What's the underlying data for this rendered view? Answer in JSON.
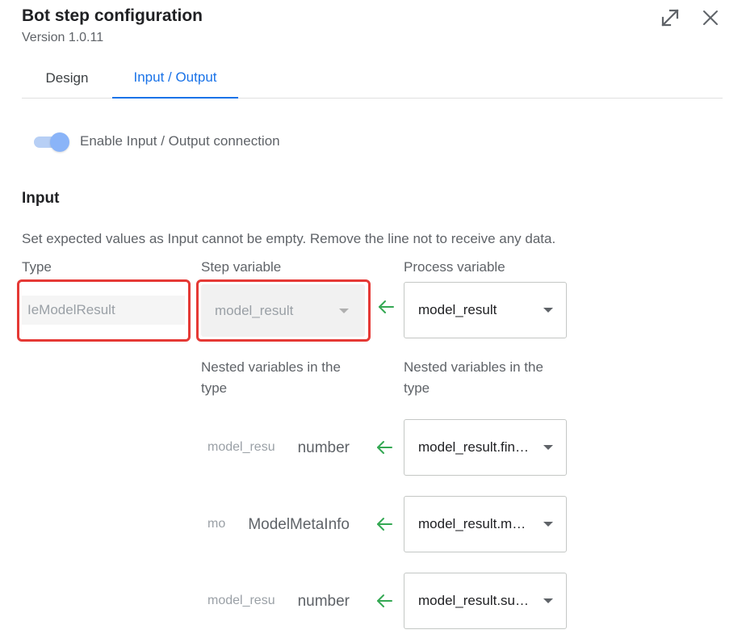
{
  "header": {
    "title": "Bot step configuration",
    "version": "Version 1.0.11"
  },
  "tabs": [
    {
      "label": "Design",
      "active": false
    },
    {
      "label": "Input / Output",
      "active": true
    }
  ],
  "toggle": {
    "label": "Enable Input / Output connection",
    "enabled": true
  },
  "input": {
    "title": "Input",
    "description": "Set expected values as Input cannot be empty. Remove the line not to receive any data.",
    "columns": {
      "type": "Type",
      "step_variable": "Step variable",
      "process_variable": "Process variable"
    },
    "main_row": {
      "type_value": "IeModelResult",
      "step_variable": "model_result",
      "process_variable": "model_result"
    },
    "nested_label": "Nested variables in the type",
    "nested_rows": [
      {
        "name": "model_resu",
        "type": "number",
        "process_variable": "model_result.fin…"
      },
      {
        "name": "mo",
        "type": "ModelMetaInfo",
        "process_variable": "model_result.m…"
      },
      {
        "name": "model_resu",
        "type": "number",
        "process_variable": "model_result.su…"
      }
    ]
  },
  "colors": {
    "accent": "#1a73e8",
    "highlight": "#e53935",
    "arrow": "#34a853"
  },
  "icons": {
    "expand": "expand-icon",
    "close": "close-icon",
    "arrow": "arrow-left-icon",
    "dropdown": "chevron-down-icon"
  }
}
